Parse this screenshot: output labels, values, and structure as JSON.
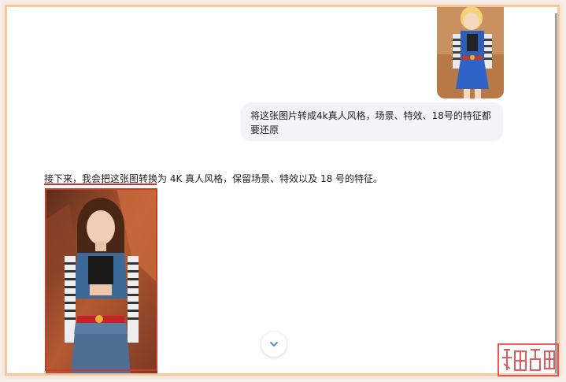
{
  "conversation": {
    "user_message": "将这张图片转成4k真人风格，场景、特效、18号的特征都要还原",
    "assistant_message": "接下来，我会把这张图转换为 4K 真人风格，保留场景、特效以及 18 号的特征。"
  },
  "icons": {
    "scroll_down": "chevron-down-icon"
  },
  "colors": {
    "bubble_bg": "#f3f4f6",
    "highlight_red": "#d8352a",
    "frame_orange": "#f3c9a2",
    "scroll_icon": "#3b82f6"
  }
}
